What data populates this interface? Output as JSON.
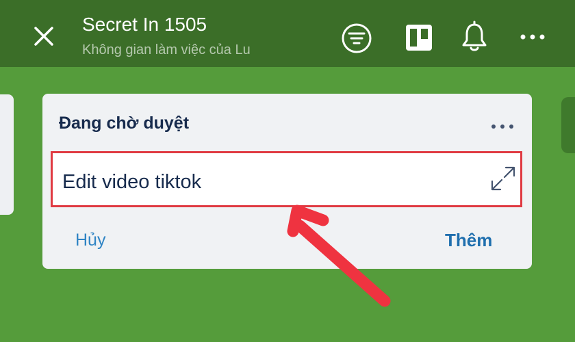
{
  "header": {
    "title": "Secret In 1505",
    "subtitle": "Không gian làm việc của Lu",
    "icons": [
      "close-icon",
      "filter-icon",
      "board-view-icon",
      "bell-icon",
      "more-icon"
    ],
    "background_color": "#3b6e28"
  },
  "board": {
    "background_color": "#559c3b"
  },
  "list": {
    "title": "Đang chờ duyệt",
    "menu_icon": "more-horizontal-icon",
    "new_card": {
      "value": "Edit video tiktok",
      "highlight_color": "#e03a42"
    },
    "cancel_label": "Hủy",
    "add_label": "Thêm"
  },
  "annotation": {
    "arrow_color": "#ef3340"
  }
}
